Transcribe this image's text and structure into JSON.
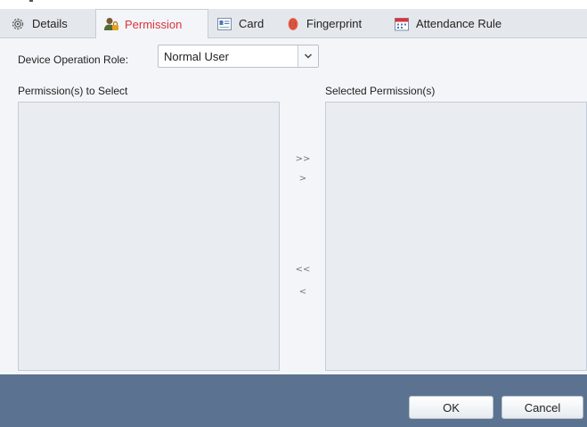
{
  "tabs": [
    {
      "label": "Details",
      "icon": "gear-icon"
    },
    {
      "label": "Permission",
      "icon": "user-lock-icon",
      "active": true
    },
    {
      "label": "Card",
      "icon": "card-icon"
    },
    {
      "label": "Fingerprint",
      "icon": "fingerprint-icon"
    },
    {
      "label": "Attendance Rule",
      "icon": "calendar-icon"
    }
  ],
  "role": {
    "label": "Device Operation Role:",
    "value": "Normal User"
  },
  "lists": {
    "available_title": "Permission(s) to Select",
    "selected_title": "Selected Permission(s)"
  },
  "transfer": {
    "add_all": ">>",
    "add": ">",
    "remove_all": "<<",
    "remove": "<"
  },
  "buttons": {
    "ok": "OK",
    "cancel": "Cancel"
  },
  "colors": {
    "active_tab_text": "#d9343b",
    "footer": "#5b7390"
  }
}
